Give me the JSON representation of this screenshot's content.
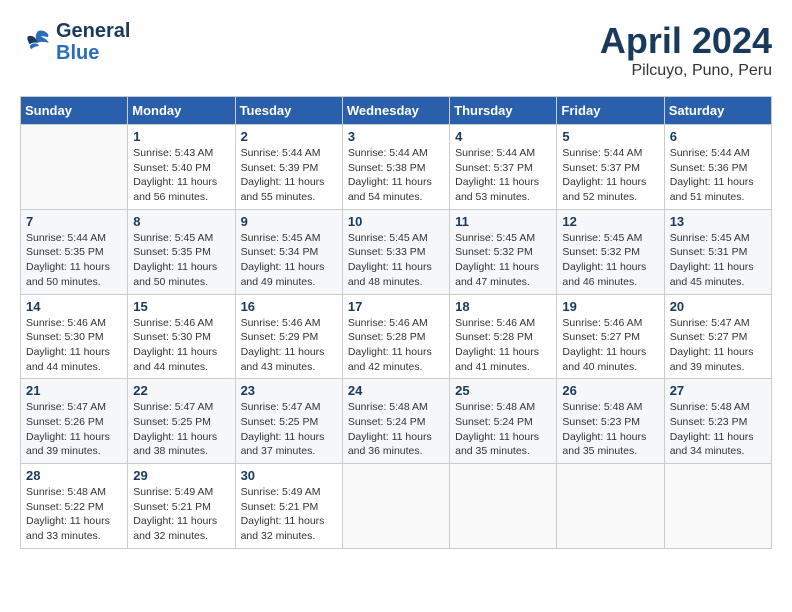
{
  "header": {
    "logo_line1": "General",
    "logo_line2": "Blue",
    "month": "April 2024",
    "location": "Pilcuyo, Puno, Peru"
  },
  "days_of_week": [
    "Sunday",
    "Monday",
    "Tuesday",
    "Wednesday",
    "Thursday",
    "Friday",
    "Saturday"
  ],
  "weeks": [
    [
      {
        "day": "",
        "info": ""
      },
      {
        "day": "1",
        "info": "Sunrise: 5:43 AM\nSunset: 5:40 PM\nDaylight: 11 hours\nand 56 minutes."
      },
      {
        "day": "2",
        "info": "Sunrise: 5:44 AM\nSunset: 5:39 PM\nDaylight: 11 hours\nand 55 minutes."
      },
      {
        "day": "3",
        "info": "Sunrise: 5:44 AM\nSunset: 5:38 PM\nDaylight: 11 hours\nand 54 minutes."
      },
      {
        "day": "4",
        "info": "Sunrise: 5:44 AM\nSunset: 5:37 PM\nDaylight: 11 hours\nand 53 minutes."
      },
      {
        "day": "5",
        "info": "Sunrise: 5:44 AM\nSunset: 5:37 PM\nDaylight: 11 hours\nand 52 minutes."
      },
      {
        "day": "6",
        "info": "Sunrise: 5:44 AM\nSunset: 5:36 PM\nDaylight: 11 hours\nand 51 minutes."
      }
    ],
    [
      {
        "day": "7",
        "info": "Sunrise: 5:44 AM\nSunset: 5:35 PM\nDaylight: 11 hours\nand 50 minutes."
      },
      {
        "day": "8",
        "info": "Sunrise: 5:45 AM\nSunset: 5:35 PM\nDaylight: 11 hours\nand 50 minutes."
      },
      {
        "day": "9",
        "info": "Sunrise: 5:45 AM\nSunset: 5:34 PM\nDaylight: 11 hours\nand 49 minutes."
      },
      {
        "day": "10",
        "info": "Sunrise: 5:45 AM\nSunset: 5:33 PM\nDaylight: 11 hours\nand 48 minutes."
      },
      {
        "day": "11",
        "info": "Sunrise: 5:45 AM\nSunset: 5:32 PM\nDaylight: 11 hours\nand 47 minutes."
      },
      {
        "day": "12",
        "info": "Sunrise: 5:45 AM\nSunset: 5:32 PM\nDaylight: 11 hours\nand 46 minutes."
      },
      {
        "day": "13",
        "info": "Sunrise: 5:45 AM\nSunset: 5:31 PM\nDaylight: 11 hours\nand 45 minutes."
      }
    ],
    [
      {
        "day": "14",
        "info": "Sunrise: 5:46 AM\nSunset: 5:30 PM\nDaylight: 11 hours\nand 44 minutes."
      },
      {
        "day": "15",
        "info": "Sunrise: 5:46 AM\nSunset: 5:30 PM\nDaylight: 11 hours\nand 44 minutes."
      },
      {
        "day": "16",
        "info": "Sunrise: 5:46 AM\nSunset: 5:29 PM\nDaylight: 11 hours\nand 43 minutes."
      },
      {
        "day": "17",
        "info": "Sunrise: 5:46 AM\nSunset: 5:28 PM\nDaylight: 11 hours\nand 42 minutes."
      },
      {
        "day": "18",
        "info": "Sunrise: 5:46 AM\nSunset: 5:28 PM\nDaylight: 11 hours\nand 41 minutes."
      },
      {
        "day": "19",
        "info": "Sunrise: 5:46 AM\nSunset: 5:27 PM\nDaylight: 11 hours\nand 40 minutes."
      },
      {
        "day": "20",
        "info": "Sunrise: 5:47 AM\nSunset: 5:27 PM\nDaylight: 11 hours\nand 39 minutes."
      }
    ],
    [
      {
        "day": "21",
        "info": "Sunrise: 5:47 AM\nSunset: 5:26 PM\nDaylight: 11 hours\nand 39 minutes."
      },
      {
        "day": "22",
        "info": "Sunrise: 5:47 AM\nSunset: 5:25 PM\nDaylight: 11 hours\nand 38 minutes."
      },
      {
        "day": "23",
        "info": "Sunrise: 5:47 AM\nSunset: 5:25 PM\nDaylight: 11 hours\nand 37 minutes."
      },
      {
        "day": "24",
        "info": "Sunrise: 5:48 AM\nSunset: 5:24 PM\nDaylight: 11 hours\nand 36 minutes."
      },
      {
        "day": "25",
        "info": "Sunrise: 5:48 AM\nSunset: 5:24 PM\nDaylight: 11 hours\nand 35 minutes."
      },
      {
        "day": "26",
        "info": "Sunrise: 5:48 AM\nSunset: 5:23 PM\nDaylight: 11 hours\nand 35 minutes."
      },
      {
        "day": "27",
        "info": "Sunrise: 5:48 AM\nSunset: 5:23 PM\nDaylight: 11 hours\nand 34 minutes."
      }
    ],
    [
      {
        "day": "28",
        "info": "Sunrise: 5:48 AM\nSunset: 5:22 PM\nDaylight: 11 hours\nand 33 minutes."
      },
      {
        "day": "29",
        "info": "Sunrise: 5:49 AM\nSunset: 5:21 PM\nDaylight: 11 hours\nand 32 minutes."
      },
      {
        "day": "30",
        "info": "Sunrise: 5:49 AM\nSunset: 5:21 PM\nDaylight: 11 hours\nand 32 minutes."
      },
      {
        "day": "",
        "info": ""
      },
      {
        "day": "",
        "info": ""
      },
      {
        "day": "",
        "info": ""
      },
      {
        "day": "",
        "info": ""
      }
    ]
  ]
}
